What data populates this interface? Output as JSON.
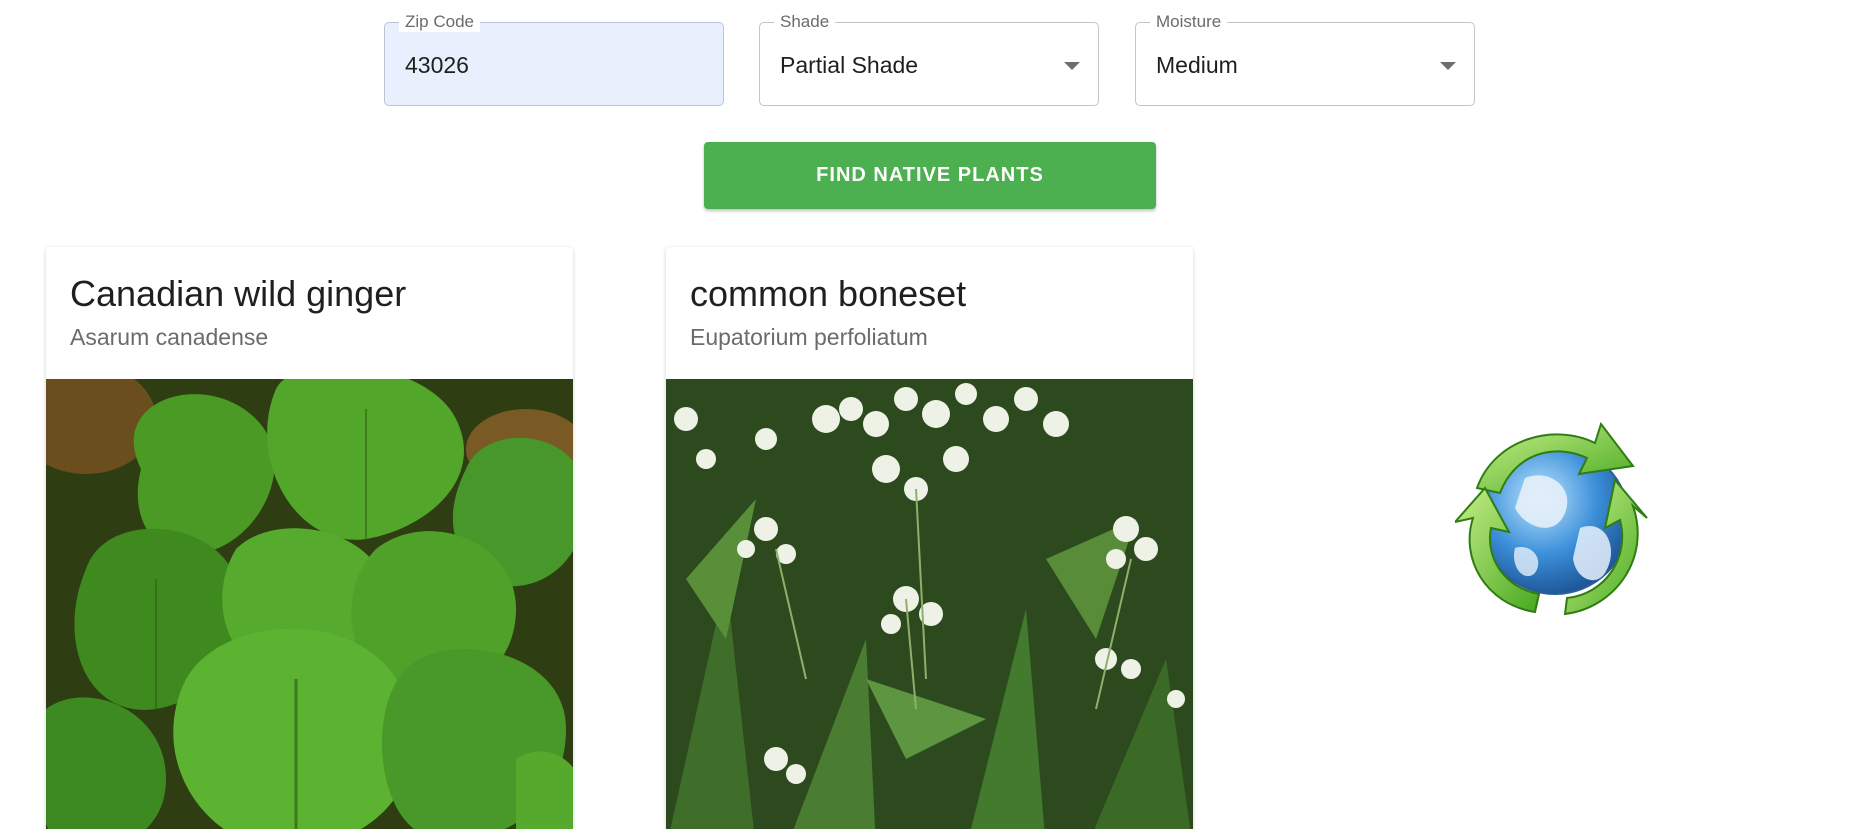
{
  "search": {
    "zip": {
      "label": "Zip Code",
      "value": "43026"
    },
    "shade": {
      "label": "Shade",
      "value": "Partial Shade"
    },
    "moisture": {
      "label": "Moisture",
      "value": "Medium"
    },
    "submit_label": "FIND NATIVE PLANTS"
  },
  "results": [
    {
      "common_name": "Canadian wild ginger",
      "scientific_name": "Asarum canadense"
    },
    {
      "common_name": "common boneset",
      "scientific_name": "Eupatorium perfoliatum"
    }
  ],
  "colors": {
    "accent": "#4caf50",
    "autofill_bg": "#e8f0fe"
  },
  "icons": {
    "dropdown": "chevron-down-icon",
    "logo": "recycling-globe-icon"
  }
}
